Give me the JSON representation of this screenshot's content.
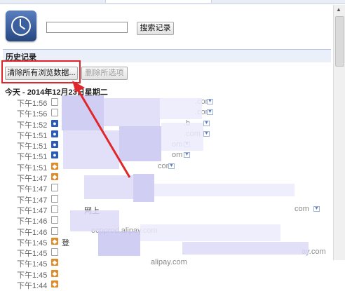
{
  "search": {
    "value": "",
    "button_label": "搜索记录"
  },
  "history": {
    "section_title": "历史记录",
    "clear_button_label": "清除所有浏览数据...",
    "delete_button_label": "删除所选项",
    "day_heading": "今天 - 2014年12月23日星期二"
  },
  "entries": [
    {
      "time": "下午1:56",
      "icon": "page-icon",
      "title": "",
      "domain": ".com"
    },
    {
      "time": "下午1:56",
      "icon": "page-icon",
      "title": "",
      "domain": ".com"
    },
    {
      "time": "下午1:52",
      "icon": "baidu-paw-icon",
      "title": "",
      "domain": ".b"
    },
    {
      "time": "下午1:51",
      "icon": "baidu-paw-icon",
      "title": "",
      "domain": ".com"
    },
    {
      "time": "下午1:51",
      "icon": "baidu-paw-icon",
      "title": "",
      "domain": "om"
    },
    {
      "time": "下午1:51",
      "icon": "baidu-paw-icon",
      "title": "",
      "domain": "om"
    },
    {
      "time": "下午1:51",
      "icon": "shield-icon",
      "title": "",
      "domain": "com"
    },
    {
      "time": "下午1:47",
      "icon": "shield-icon",
      "title": "",
      "domain": ""
    },
    {
      "time": "下午1:47",
      "icon": "page-icon",
      "title": "",
      "domain": ""
    },
    {
      "time": "下午1:47",
      "icon": "page-icon",
      "title": "",
      "domain": ""
    },
    {
      "time": "下午1:47",
      "icon": "page-icon",
      "title": "网上",
      "domain": "com"
    },
    {
      "time": "下午1:46",
      "icon": "page-icon",
      "title": "",
      "domain": ""
    },
    {
      "time": "下午1:46",
      "icon": "page-icon",
      "title": "",
      "domain": "ocpprod.alipay.com"
    },
    {
      "time": "下午1:45",
      "icon": "shield-icon",
      "title": "登",
      "domain": ""
    },
    {
      "time": "下午1:45",
      "icon": "page-icon",
      "title": "",
      "domain": "ay.com"
    },
    {
      "time": "下午1:45",
      "icon": "shield-icon",
      "title": "",
      "domain": "alipay.com"
    },
    {
      "time": "下午1:45",
      "icon": "shield-icon",
      "title": "",
      "domain": ""
    },
    {
      "time": "下午1:44",
      "icon": "shield-icon",
      "title": "",
      "domain": ""
    }
  ]
}
